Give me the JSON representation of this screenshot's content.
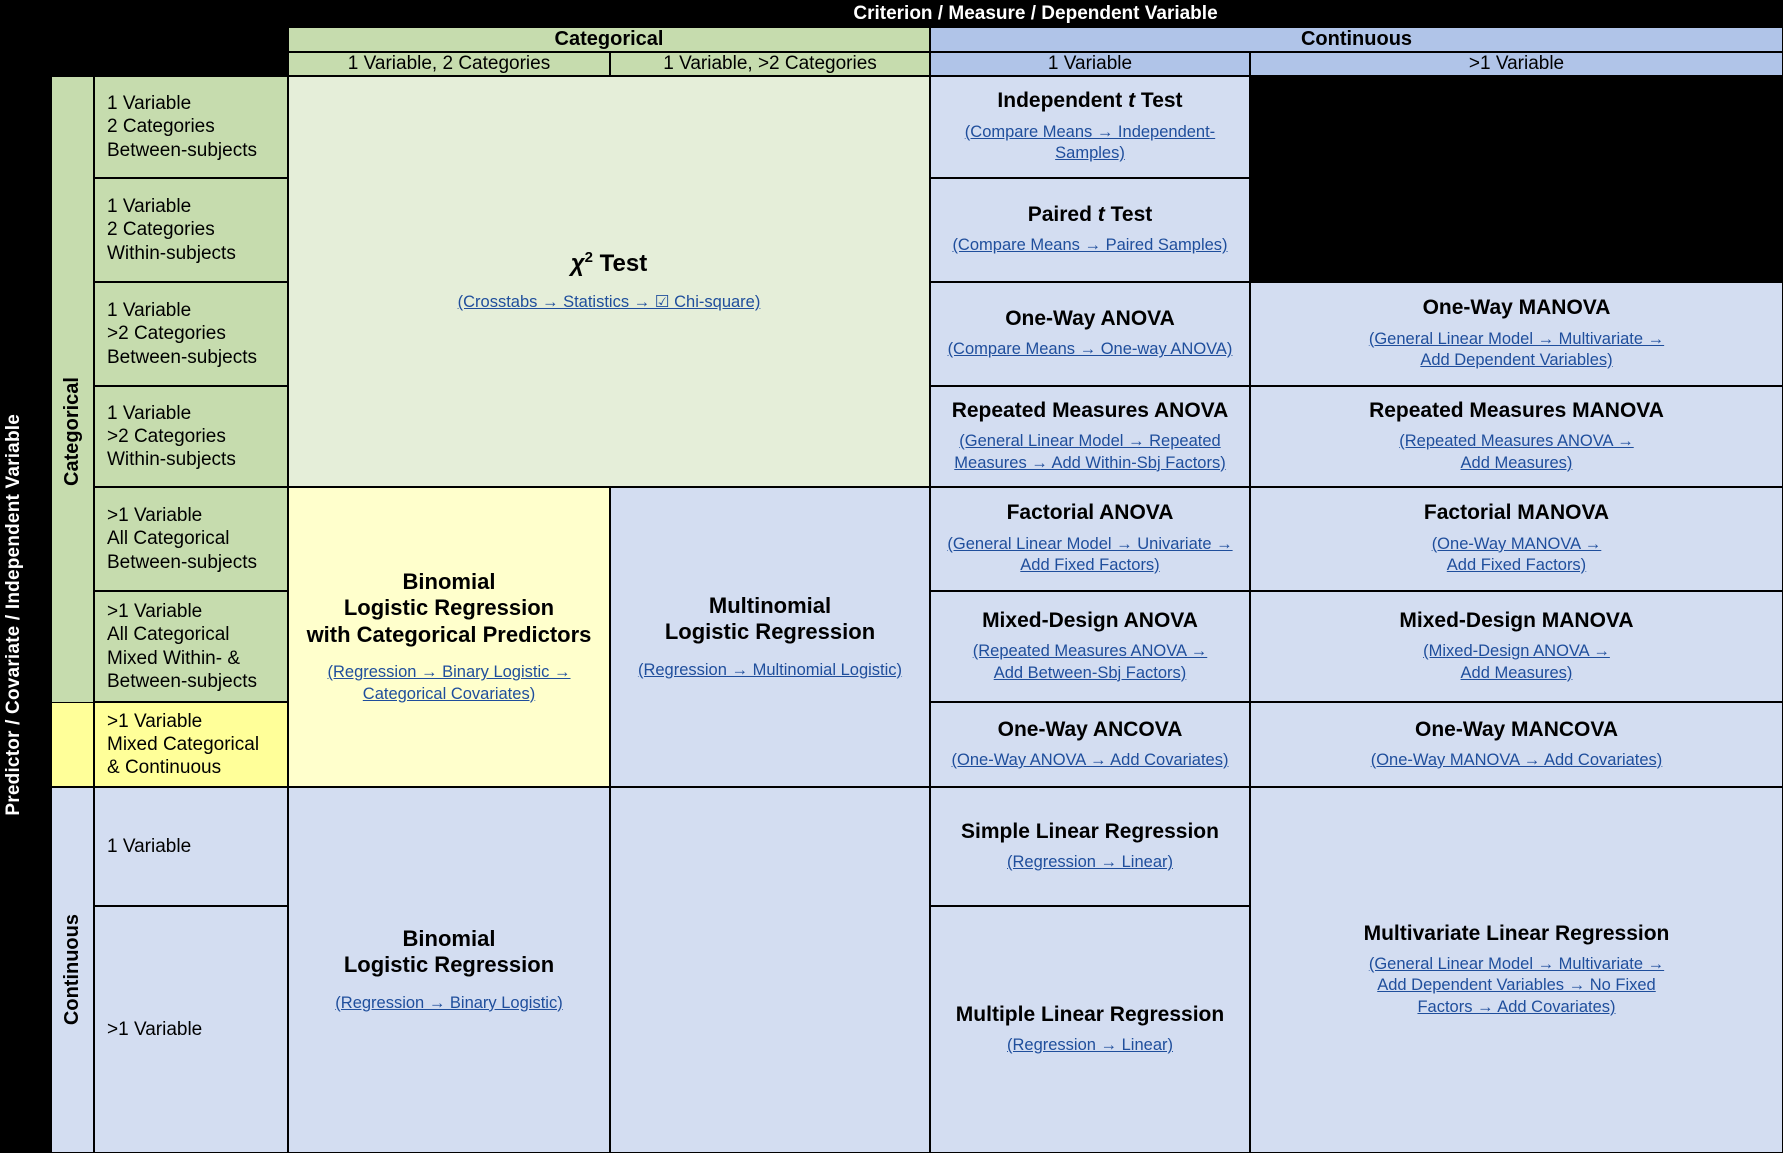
{
  "banners": {
    "row_axis": "Predictor / Covariate / Independent Variable",
    "column_axis": "Criterion / Measure / Dependent Variable",
    "row_group_categorical": "Categorical",
    "row_group_continuous": "Continuous"
  },
  "column_headers": {
    "categorical": "Categorical",
    "continuous": "Continuous",
    "cat_1var_2cat": "1 Variable, 2 Categories",
    "cat_1var_gt2cat": "1 Variable, >2 Categories",
    "cont_1var": "1 Variable",
    "cont_gt1var": ">1 Variable"
  },
  "row_labels": {
    "r1": "1 Variable\n2 Categories\nBetween-subjects",
    "r2": "1 Variable\n2 Categories\nWithin-subjects",
    "r3": "1 Variable\n>2 Categories\nBetween-subjects",
    "r4": "1 Variable\n>2 Categories\nWithin-subjects",
    "r5": ">1 Variable\nAll Categorical\nBetween-subjects",
    "r6": ">1 Variable\nAll Categorical\nMixed Within- &\nBetween-subjects",
    "r7": ">1 Variable\nMixed Categorical\n& Continuous",
    "r8": "1 Variable",
    "r9": ">1 Variable"
  },
  "cells": {
    "chi_square": {
      "title_chi": "χ",
      "title_sup": "2",
      "title_rest": " Test",
      "path": "(Crosstabs → Statistics → ☑ Chi-square)"
    },
    "binomial_cat": {
      "title": "Binomial\nLogistic Regression\nwith Categorical Predictors",
      "path": "(Regression → Binary Logistic →\nCategorical Covariates)"
    },
    "binomial": {
      "title": "Binomial\nLogistic Regression",
      "path": "(Regression → Binary Logistic)"
    },
    "multinomial": {
      "title": "Multinomial\nLogistic Regression",
      "path": "(Regression → Multinomial Logistic)"
    },
    "independent_t": {
      "title_pre": "Independent ",
      "title_ital": "t",
      "title_post": " Test",
      "path": "(Compare Means → Independent-\nSamples)"
    },
    "paired_t": {
      "title_pre": "Paired ",
      "title_ital": "t",
      "title_post": " Test",
      "path": "(Compare Means → Paired Samples)"
    },
    "one_way_anova": {
      "title": "One-Way ANOVA",
      "path": "(Compare Means → One-way ANOVA)"
    },
    "rm_anova": {
      "title": "Repeated Measures ANOVA",
      "path": "(General Linear Model → Repeated\nMeasures → Add Within-Sbj Factors)"
    },
    "factorial_anova": {
      "title": "Factorial ANOVA",
      "path": "(General Linear Model → Univariate →\nAdd Fixed Factors)"
    },
    "mixed_anova": {
      "title": "Mixed-Design ANOVA",
      "path": "(Repeated Measures ANOVA →\nAdd Between-Sbj Factors)"
    },
    "one_way_ancova": {
      "title": "One-Way ANCOVA",
      "path": "(One-Way ANOVA → Add Covariates)"
    },
    "simple_linear": {
      "title": "Simple Linear Regression",
      "path": "(Regression → Linear)"
    },
    "multiple_linear": {
      "title": "Multiple Linear Regression",
      "path": "(Regression → Linear)"
    },
    "one_way_manova": {
      "title": "One-Way MANOVA",
      "path": "(General Linear Model → Multivariate →\nAdd Dependent Variables)"
    },
    "rm_manova": {
      "title": "Repeated Measures MANOVA",
      "path": "(Repeated Measures ANOVA →\nAdd Measures)"
    },
    "factorial_manova": {
      "title": "Factorial MANOVA",
      "path": "(One-Way MANOVA →\nAdd Fixed Factors)"
    },
    "mixed_manova": {
      "title": "Mixed-Design MANOVA",
      "path": "(Mixed-Design ANOVA →\nAdd Measures)"
    },
    "one_way_mancova": {
      "title": "One-Way MANCOVA",
      "path": "(One-Way MANOVA → Add Covariates)"
    },
    "multivariate_linear": {
      "title": "Multivariate Linear Regression",
      "path": "(General Linear Model → Multivariate →\nAdd Dependent Variables → No Fixed\nFactors → Add Covariates)"
    }
  },
  "colors": {
    "categorical_header": "#c6dcae",
    "continuous_header": "#b0c4e8",
    "categorical_body": "#e5eed9",
    "continuous_body": "#d3ddf1",
    "mixed_row": "#ffff99",
    "mixed_cell": "#ffffcc",
    "link_text": "#1f4e9c",
    "empty_cell": "#000000"
  }
}
